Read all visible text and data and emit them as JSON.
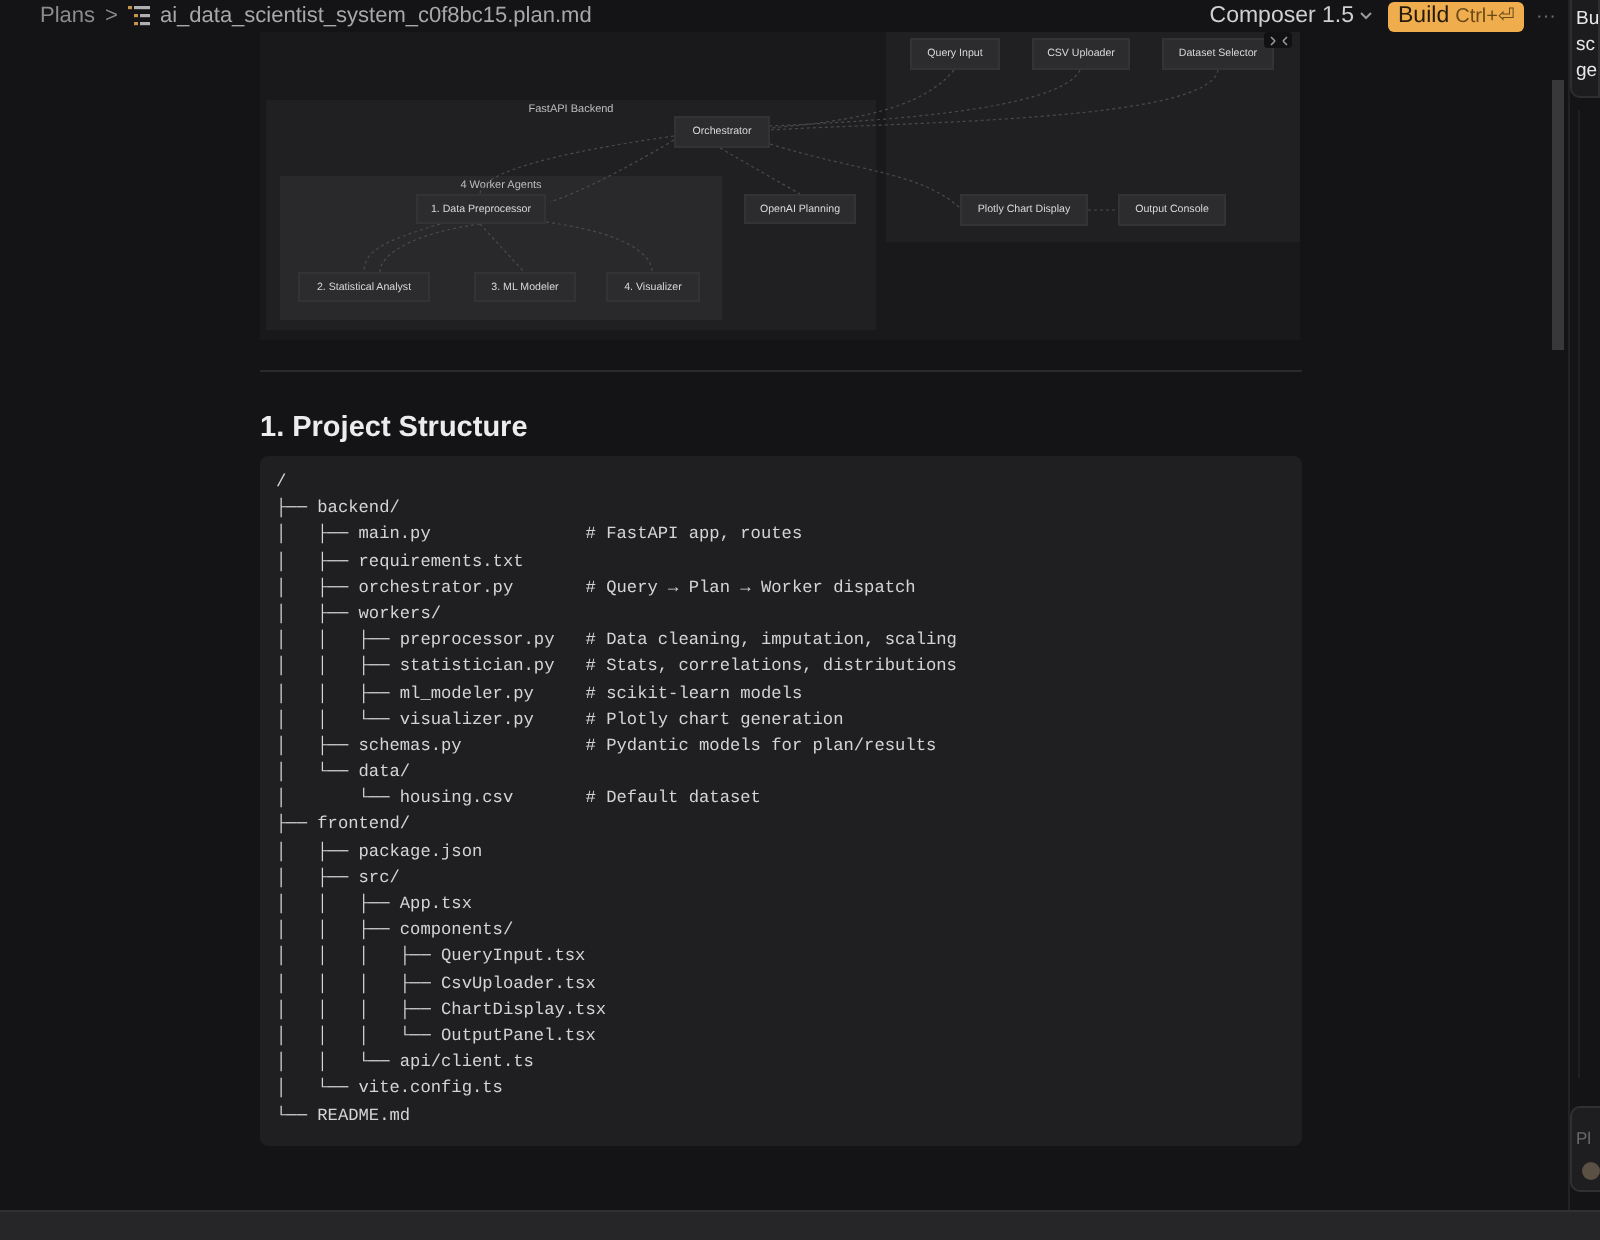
{
  "breadcrumb": {
    "root": "Plans",
    "separator": ">",
    "file": "ai_data_scientist_system_c0f8bc15.plan.md"
  },
  "toolbar": {
    "model": "Composer 1.5",
    "build_label": "Build",
    "build_shortcut": "Ctrl+⏎",
    "more": "···"
  },
  "diagram": {
    "groups": [
      {
        "label": "FastAPI Backend"
      },
      {
        "label": "4 Worker Agents"
      }
    ],
    "nodes": [
      {
        "label": "Query Input"
      },
      {
        "label": "CSV Uploader"
      },
      {
        "label": "Dataset Selector"
      },
      {
        "label": "Orchestrator"
      },
      {
        "label": "1. Data Preprocessor"
      },
      {
        "label": "OpenAI Planning"
      },
      {
        "label": "Plotly Chart Display"
      },
      {
        "label": "Output Console"
      },
      {
        "label": "2. Statistical Analyst"
      },
      {
        "label": "3. ML Modeler"
      },
      {
        "label": "4. Visualizer"
      }
    ]
  },
  "section": {
    "heading": "1. Project Structure",
    "code_lines": [
      {
        "path": "/"
      },
      {
        "path": "├── backend/"
      },
      {
        "path": "│   ├── main.py",
        "comment": "# FastAPI app, routes"
      },
      {
        "path": "│   ├── requirements.txt"
      },
      {
        "path": "│   ├── orchestrator.py",
        "comment": "# Query → Plan → Worker dispatch"
      },
      {
        "path": "│   ├── workers/"
      },
      {
        "path": "│   │   ├── preprocessor.py",
        "comment": "# Data cleaning, imputation, scaling"
      },
      {
        "path": "│   │   ├── statistician.py",
        "comment": "# Stats, correlations, distributions"
      },
      {
        "path": "│   │   ├── ml_modeler.py",
        "comment": "# scikit-learn models"
      },
      {
        "path": "│   │   └── visualizer.py",
        "comment": "# Plotly chart generation"
      },
      {
        "path": "│   ├── schemas.py",
        "comment": "# Pydantic models for plan/results"
      },
      {
        "path": "│   └── data/"
      },
      {
        "path": "│       └── housing.csv",
        "comment": "# Default dataset"
      },
      {
        "path": "├── frontend/"
      },
      {
        "path": "│   ├── package.json"
      },
      {
        "path": "│   ├── src/"
      },
      {
        "path": "│   │   ├── App.tsx"
      },
      {
        "path": "│   │   ├── components/"
      },
      {
        "path": "│   │   │   ├── QueryInput.tsx"
      },
      {
        "path": "│   │   │   ├── CsvUploader.tsx"
      },
      {
        "path": "│   │   │   ├── ChartDisplay.tsx"
      },
      {
        "path": "│   │   │   └── OutputPanel.tsx"
      },
      {
        "path": "│   │   └── api/client.ts"
      },
      {
        "path": "│   └── vite.config.ts"
      },
      {
        "path": "└── README.md"
      }
    ]
  },
  "side_panel": {
    "message_lines": [
      "Bu",
      "sc",
      "ge"
    ],
    "input_placeholder": "Pl"
  }
}
